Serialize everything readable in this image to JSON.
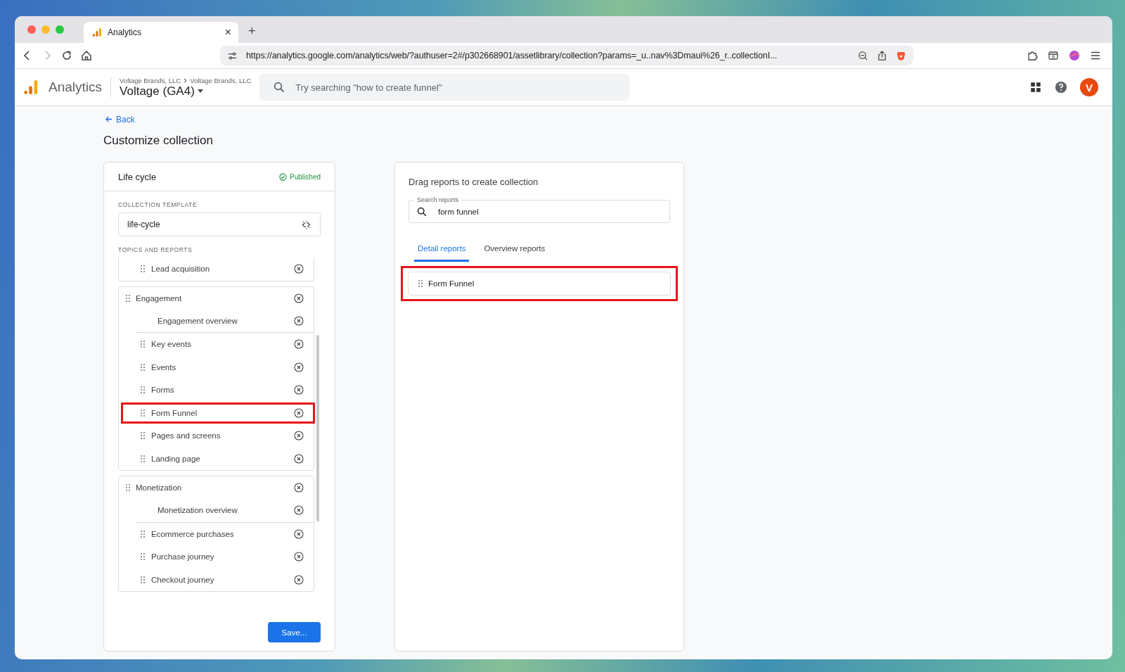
{
  "browser": {
    "tab": {
      "title": "Analytics",
      "close": "×"
    },
    "new_tab": "+",
    "url": "https://analytics.google.com/analytics/web/?authuser=2#/p302668901/assetlibrary/collection?params=_u..nav%3Dmaui%26_r..collectionI..."
  },
  "header": {
    "product": "Analytics",
    "breadcrumb": [
      "Voltage Brands, LLC",
      "Voltage Brands, LLC"
    ],
    "property": "Voltage (GA4)",
    "search": {
      "placeholder": "Try searching \"how to create funnel\""
    },
    "avatar": "V"
  },
  "back": "Back",
  "title": "Customize collection",
  "editor": {
    "name": "Life cycle",
    "status": "Published",
    "template_label": "COLLECTION TEMPLATE",
    "template": "life-cycle",
    "topics_label": "TOPICS AND REPORTS",
    "groups": [
      {
        "items": [
          {
            "label": "Lead acquisition",
            "kind": "report",
            "highlighted": false
          }
        ]
      },
      {
        "title": "Engagement",
        "items": [
          {
            "label": "Engagement overview",
            "kind": "overview",
            "highlighted": false
          },
          {
            "label": "Key events",
            "kind": "report",
            "highlighted": false
          },
          {
            "label": "Events",
            "kind": "report",
            "highlighted": false
          },
          {
            "label": "Forms",
            "kind": "report",
            "highlighted": false
          },
          {
            "label": "Form Funnel",
            "kind": "report",
            "highlighted": true
          },
          {
            "label": "Pages and screens",
            "kind": "report",
            "highlighted": false
          },
          {
            "label": "Landing page",
            "kind": "report",
            "highlighted": false
          }
        ]
      },
      {
        "title": "Monetization",
        "items": [
          {
            "label": "Monetization overview",
            "kind": "overview",
            "highlighted": false
          },
          {
            "label": "Ecommerce purchases",
            "kind": "report",
            "highlighted": false
          },
          {
            "label": "Purchase journey",
            "kind": "report",
            "highlighted": false
          },
          {
            "label": "Checkout journey",
            "kind": "report",
            "highlighted": false
          }
        ]
      }
    ],
    "save": "Save..."
  },
  "library": {
    "title": "Drag reports to create collection",
    "search": {
      "label": "Search reports",
      "value": "form funnel"
    },
    "tabs": [
      {
        "label": "Detail reports",
        "selected": true
      },
      {
        "label": "Overview reports",
        "selected": false
      }
    ],
    "results": [
      {
        "label": "Form Funnel",
        "highlighted": true
      }
    ]
  }
}
